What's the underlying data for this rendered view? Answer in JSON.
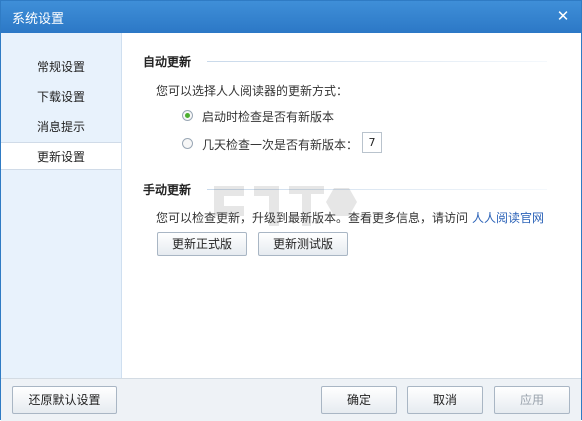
{
  "window": {
    "title": "系统设置",
    "close_glyph": "✕"
  },
  "sidebar": {
    "items": [
      {
        "label": "常规设置"
      },
      {
        "label": "下载设置"
      },
      {
        "label": "消息提示"
      },
      {
        "label": "更新设置"
      }
    ]
  },
  "auto_update": {
    "title": "自动更新",
    "description": "您可以选择人人阅读器的更新方式：",
    "option1": "启动时检查是否有新版本",
    "option2": "几天检查一次是否有新版本：",
    "days_value": "7"
  },
  "manual_update": {
    "title": "手动更新",
    "description": "您可以检查更新，升级到最新版本。查看更多信息，请访问",
    "link": "人人阅读官网",
    "btn_stable": "更新正式版",
    "btn_beta": "更新测试版"
  },
  "footer": {
    "restore_defaults": "还原默认设置",
    "ok": "确定",
    "cancel": "取消",
    "apply": "应用"
  }
}
